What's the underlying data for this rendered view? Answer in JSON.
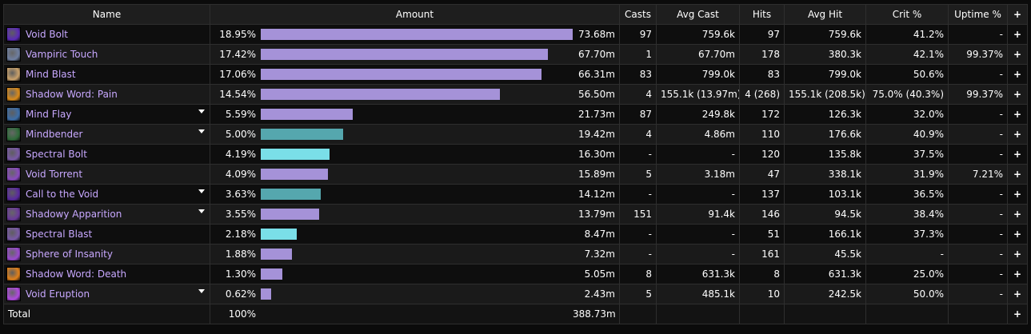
{
  "headers": {
    "name": "Name",
    "amount": "Amount",
    "casts": "Casts",
    "avg_cast": "Avg Cast",
    "hits": "Hits",
    "avg_hit": "Avg Hit",
    "crit": "Crit %",
    "uptime": "Uptime %",
    "plus": "+"
  },
  "colors": {
    "bar_default": "#a592d8",
    "bar_teal": "#55a7ae",
    "bar_cyan": "#7adfe8"
  },
  "rows": [
    {
      "name": "Void Bolt",
      "icon": "void-bolt-icon",
      "iconColor": "#5b2bb8",
      "expand": false,
      "pct": "18.95%",
      "share": 0.1895,
      "bar": "#a592d8",
      "amount": "73.68m",
      "casts": "97",
      "avg_cast": "759.6k",
      "hits": "97",
      "avg_hit": "759.6k",
      "crit": "41.2%",
      "uptime": "-",
      "plus": "+"
    },
    {
      "name": "Vampiric Touch",
      "icon": "vampiric-touch-icon",
      "iconColor": "#6f7fa0",
      "expand": false,
      "pct": "17.42%",
      "share": 0.1742,
      "bar": "#a592d8",
      "amount": "67.70m",
      "casts": "1",
      "avg_cast": "67.70m",
      "hits": "178",
      "avg_hit": "380.3k",
      "crit": "42.1%",
      "uptime": "99.37%",
      "plus": "+"
    },
    {
      "name": "Mind Blast",
      "icon": "mind-blast-icon",
      "iconColor": "#c9a16b",
      "expand": false,
      "pct": "17.06%",
      "share": 0.1706,
      "bar": "#a592d8",
      "amount": "66.31m",
      "casts": "83",
      "avg_cast": "799.0k",
      "hits": "83",
      "avg_hit": "799.0k",
      "crit": "50.6%",
      "uptime": "-",
      "plus": "+"
    },
    {
      "name": "Shadow Word: Pain",
      "icon": "shadow-word-pain-icon",
      "iconColor": "#d98a1a",
      "expand": false,
      "pct": "14.54%",
      "share": 0.1454,
      "bar": "#a592d8",
      "amount": "56.50m",
      "casts": "4",
      "avg_cast": "155.1k (13.97m)",
      "hits": "4 (268)",
      "avg_hit": "155.1k (208.5k)",
      "crit": "75.0% (40.3%)",
      "uptime": "99.37%",
      "plus": "+"
    },
    {
      "name": "Mind Flay",
      "icon": "mind-flay-icon",
      "iconColor": "#3d6ea8",
      "expand": true,
      "pct": "5.59%",
      "share": 0.0559,
      "bar": "#a592d8",
      "amount": "21.73m",
      "casts": "87",
      "avg_cast": "249.8k",
      "hits": "172",
      "avg_hit": "126.3k",
      "crit": "32.0%",
      "uptime": "-",
      "plus": "+"
    },
    {
      "name": "Mindbender",
      "icon": "mindbender-icon",
      "iconColor": "#2f6b3a",
      "expand": true,
      "pct": "5.00%",
      "share": 0.05,
      "bar": "#55a7ae",
      "amount": "19.42m",
      "casts": "4",
      "avg_cast": "4.86m",
      "hits": "110",
      "avg_hit": "176.6k",
      "crit": "40.9%",
      "uptime": "-",
      "plus": "+"
    },
    {
      "name": "Spectral Bolt",
      "icon": "spectral-bolt-icon",
      "iconColor": "#7a5aa8",
      "expand": false,
      "pct": "4.19%",
      "share": 0.0419,
      "bar": "#7adfe8",
      "amount": "16.30m",
      "casts": "-",
      "avg_cast": "-",
      "hits": "120",
      "avg_hit": "135.8k",
      "crit": "37.5%",
      "uptime": "-",
      "plus": "+"
    },
    {
      "name": "Void Torrent",
      "icon": "void-torrent-icon",
      "iconColor": "#8a4bc0",
      "expand": false,
      "pct": "4.09%",
      "share": 0.0409,
      "bar": "#a592d8",
      "amount": "15.89m",
      "casts": "5",
      "avg_cast": "3.18m",
      "hits": "47",
      "avg_hit": "338.1k",
      "crit": "31.9%",
      "uptime": "7.21%",
      "plus": "+"
    },
    {
      "name": "Call to the Void",
      "icon": "call-to-the-void-icon",
      "iconColor": "#5a2aa0",
      "expand": true,
      "pct": "3.63%",
      "share": 0.0363,
      "bar": "#55a7ae",
      "amount": "14.12m",
      "casts": "-",
      "avg_cast": "-",
      "hits": "137",
      "avg_hit": "103.1k",
      "crit": "36.5%",
      "uptime": "-",
      "plus": "+"
    },
    {
      "name": "Shadowy Apparition",
      "icon": "shadowy-apparition-icon",
      "iconColor": "#6a3a9a",
      "expand": true,
      "pct": "3.55%",
      "share": 0.0355,
      "bar": "#a592d8",
      "amount": "13.79m",
      "casts": "151",
      "avg_cast": "91.4k",
      "hits": "146",
      "avg_hit": "94.5k",
      "crit": "38.4%",
      "uptime": "-",
      "plus": "+"
    },
    {
      "name": "Spectral Blast",
      "icon": "spectral-blast-icon",
      "iconColor": "#7a5aa8",
      "expand": false,
      "pct": "2.18%",
      "share": 0.0218,
      "bar": "#7adfe8",
      "amount": "8.47m",
      "casts": "-",
      "avg_cast": "-",
      "hits": "51",
      "avg_hit": "166.1k",
      "crit": "37.3%",
      "uptime": "-",
      "plus": "+"
    },
    {
      "name": "Sphere of Insanity",
      "icon": "sphere-of-insanity-icon",
      "iconColor": "#9a4ad0",
      "expand": false,
      "pct": "1.88%",
      "share": 0.0188,
      "bar": "#a592d8",
      "amount": "7.32m",
      "casts": "-",
      "avg_cast": "-",
      "hits": "161",
      "avg_hit": "45.5k",
      "crit": "-",
      "uptime": "-",
      "plus": "+"
    },
    {
      "name": "Shadow Word: Death",
      "icon": "shadow-word-death-icon",
      "iconColor": "#e0801a",
      "expand": false,
      "pct": "1.30%",
      "share": 0.013,
      "bar": "#a592d8",
      "amount": "5.05m",
      "casts": "8",
      "avg_cast": "631.3k",
      "hits": "8",
      "avg_hit": "631.3k",
      "crit": "25.0%",
      "uptime": "-",
      "plus": "+"
    },
    {
      "name": "Void Eruption",
      "icon": "void-eruption-icon",
      "iconColor": "#b04ae0",
      "expand": true,
      "pct": "0.62%",
      "share": 0.0062,
      "bar": "#a592d8",
      "amount": "2.43m",
      "casts": "5",
      "avg_cast": "485.1k",
      "hits": "10",
      "avg_hit": "242.5k",
      "crit": "50.0%",
      "uptime": "-",
      "plus": "+"
    }
  ],
  "total": {
    "label": "Total",
    "pct": "100%",
    "amount": "388.73m",
    "plus": "+"
  }
}
